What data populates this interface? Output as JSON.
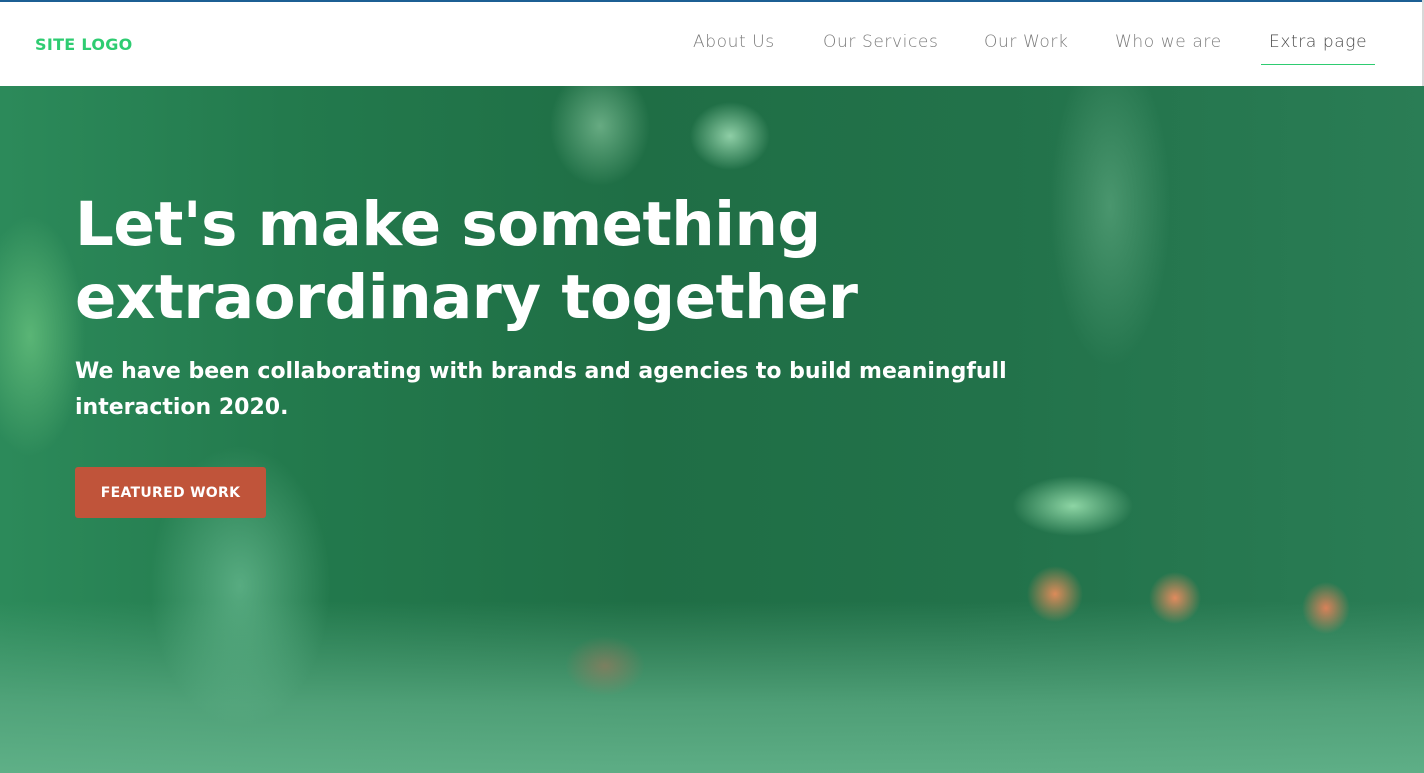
{
  "colors": {
    "brand_green": "#2ecc71",
    "nav_text": "#7a7a7a",
    "nav_active_text": "#4a4a4a",
    "top_accent": "#1c5f94",
    "cta_background": "#c0543a",
    "hero_overlay": "#237a4d"
  },
  "header": {
    "logo": "SITE LOGO",
    "nav": [
      {
        "label": "About Us",
        "active": false
      },
      {
        "label": "Our Services",
        "active": false
      },
      {
        "label": "Our Work",
        "active": false
      },
      {
        "label": "Who we are",
        "active": false
      },
      {
        "label": "Extra page",
        "active": true
      }
    ]
  },
  "hero": {
    "title": "Let's make something extraordinary together",
    "subtitle": "We have been collaborating with brands and agencies to build meaningfull interaction 2020.",
    "cta_label": "FEATURED WORK"
  }
}
